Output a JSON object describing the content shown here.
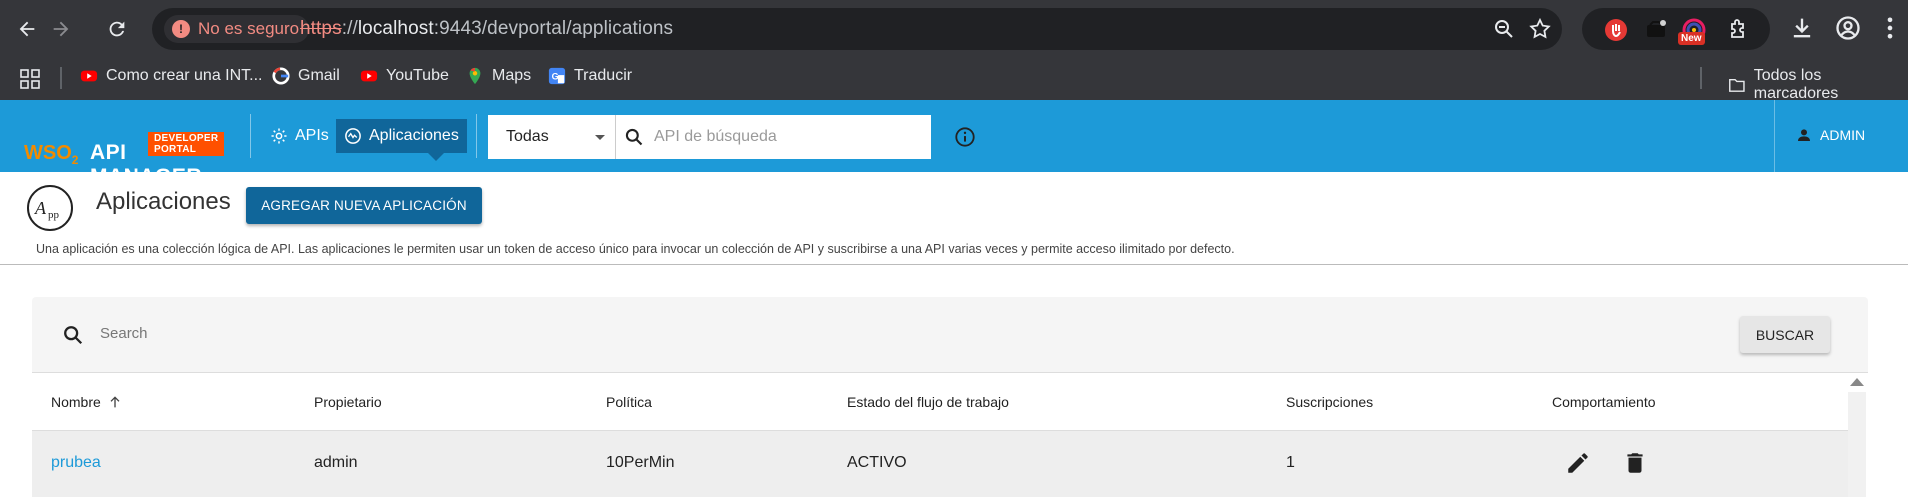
{
  "browser": {
    "security_label": "No es seguro",
    "url_scheme": "https",
    "url_sep": "://",
    "url_host": "localhost",
    "url_rest": ":9443/devportal/applications",
    "ext_badge": "New",
    "bookmarks": [
      {
        "label": "Como crear una INT...",
        "icon": "youtube-icon"
      },
      {
        "label": "Gmail",
        "icon": "google-icon"
      },
      {
        "label": "YouTube",
        "icon": "youtube-icon"
      },
      {
        "label": "Maps",
        "icon": "maps-icon"
      },
      {
        "label": "Traducir",
        "icon": "translate-icon"
      }
    ],
    "all_bookmarks": "Todos los marcadores"
  },
  "header": {
    "badge": "DEVELOPER PORTAL",
    "brand_prefix": "WSO",
    "brand_sub": "2",
    "brand": "API MANAGER",
    "nav": [
      {
        "label": "APIs",
        "icon": "gear-icon",
        "active": false
      },
      {
        "label": "Aplicaciones",
        "icon": "applications-icon",
        "active": true
      }
    ],
    "select_value": "Todas",
    "search_placeholder": "API de búsqueda",
    "user": "ADMIN",
    "accent": "#1d9ad8"
  },
  "page": {
    "logo_text": "App",
    "title": "Aplicaciones",
    "add_button": "AGREGAR NUEVA APLICACIÓN",
    "description": "Una aplicación es una colección lógica de API. Las aplicaciones le permiten usar un token de acceso único para invocar un colección de API y suscribirse a una API varias veces y permite acceso ilimitado por defecto."
  },
  "table": {
    "search_placeholder": "Search",
    "search_button": "BUSCAR",
    "columns": [
      "Nombre",
      "Propietario",
      "Política",
      "Estado del flujo de trabajo",
      "Suscripciones",
      "Comportamiento"
    ],
    "rows": [
      {
        "name": "prubea",
        "owner": "admin",
        "policy": "10PerMin",
        "status": "ACTIVO",
        "subscriptions": "1"
      }
    ]
  }
}
